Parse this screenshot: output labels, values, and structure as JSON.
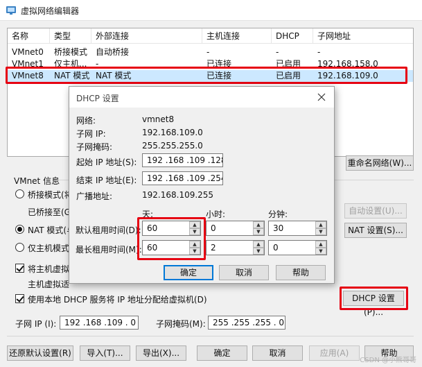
{
  "window": {
    "title": "虚拟网络编辑器"
  },
  "columns": [
    "名称",
    "类型",
    "外部连接",
    "主机连接",
    "DHCP",
    "子网地址"
  ],
  "rows": [
    [
      "VMnet0",
      "桥接模式",
      "自动桥接",
      "-",
      "-",
      "-"
    ],
    [
      "VMnet1",
      "仅主机...",
      "-",
      "已连接",
      "已启用",
      "192.168.158.0"
    ],
    [
      "VMnet8",
      "NAT 模式",
      "NAT 模式",
      "已连接",
      "已启用",
      "192.168.109.0"
    ]
  ],
  "list_buttons": {
    "rename": "重命名网络(W)..."
  },
  "vmnet_info": {
    "group_label": "VMnet 信息",
    "bridge_radio": "桥接模式(将",
    "bridged_to": "已桥接至(G",
    "auto_settings": "自动设置(U)...",
    "nat_radio": "NAT 模式(与",
    "nat_settings": "NAT 设置(S)...",
    "host_only_radio": "仅主机模式",
    "connect_host_check": "将主机虚拟",
    "host_adapter_name": "主机虚拟适",
    "use_dhcp_check": "使用本地 DHCP 服务将 IP 地址分配给虚拟机(D)",
    "dhcp_settings": "DHCP 设置(P)...",
    "subnet_ip_label": "子网 IP (I):",
    "subnet_ip_value": "192 .168 .109 .  0",
    "subnet_mask_label": "子网掩码(M):",
    "subnet_mask_value": "255 .255 .255 .  0"
  },
  "footer": {
    "restore": "还原默认设置(R)",
    "import": "导入(T)...",
    "export": "导出(X)...",
    "ok": "确定",
    "cancel": "取消",
    "apply": "应用(A)",
    "help": "帮助"
  },
  "dhcp_dialog": {
    "title": "DHCP 设置",
    "network_label": "网络:",
    "network_value": "vmnet8",
    "subnet_ip_label": "子网 IP:",
    "subnet_ip_value": "192.168.109.0",
    "subnet_mask_label": "子网掩码:",
    "subnet_mask_value": "255.255.255.0",
    "start_ip_label": "起始 IP 地址(S):",
    "start_ip_value": "192 .168 .109 .128",
    "end_ip_label": "结束 IP 地址(E):",
    "end_ip_value": "192 .168 .109 .254",
    "broadcast_label": "广播地址:",
    "broadcast_value": "192.168.109.255",
    "col_days": "天:",
    "col_hours": "小时:",
    "col_minutes": "分钟:",
    "default_lease_label": "默认租用时间(D):",
    "default_lease": {
      "days": "60",
      "hours": "0",
      "minutes": "30"
    },
    "max_lease_label": "最长租用时间(M):",
    "max_lease": {
      "days": "60",
      "hours": "2",
      "minutes": "0"
    },
    "ok": "确定",
    "cancel": "取消",
    "help": "帮助"
  },
  "watermark": "CSDN @小熊哥哥",
  "highlight_color": "#e60012"
}
